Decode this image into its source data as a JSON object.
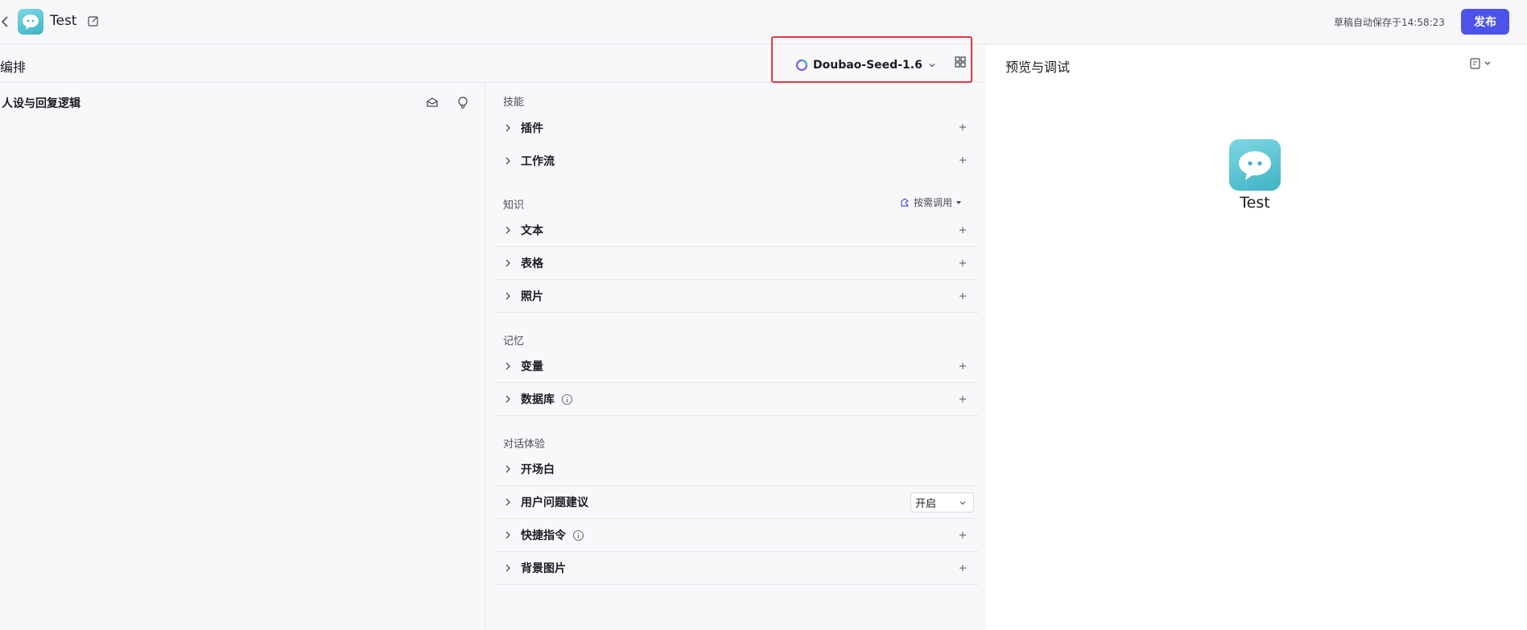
{
  "topbar": {
    "bot_name": "Test",
    "autosave_text": "草稿自动保存于14:58:23",
    "publish_label": "发布"
  },
  "orchestration": {
    "title": "编排",
    "model_name": "Doubao-Seed-1.6"
  },
  "persona": {
    "title": "人设与回复逻辑"
  },
  "skills": {
    "section": "技能",
    "items": [
      {
        "label": "插件"
      },
      {
        "label": "工作流"
      }
    ]
  },
  "knowledge": {
    "section": "知识",
    "mode_label": "按需调用",
    "items": [
      {
        "label": "文本"
      },
      {
        "label": "表格"
      },
      {
        "label": "照片"
      }
    ]
  },
  "memory": {
    "section": "记忆",
    "items": [
      {
        "label": "变量"
      },
      {
        "label": "数据库"
      }
    ]
  },
  "dialog": {
    "section": "对话体验",
    "items": [
      {
        "label": "开场白"
      },
      {
        "label": "用户问题建议",
        "value": "开启"
      },
      {
        "label": "快捷指令"
      },
      {
        "label": "背景图片"
      }
    ]
  },
  "preview": {
    "title": "预览与调试",
    "bot_name": "Test"
  },
  "colors": {
    "accent": "#4d53e8",
    "highlight": "#e0383e",
    "avatar_teal": "#3fb3c5"
  }
}
